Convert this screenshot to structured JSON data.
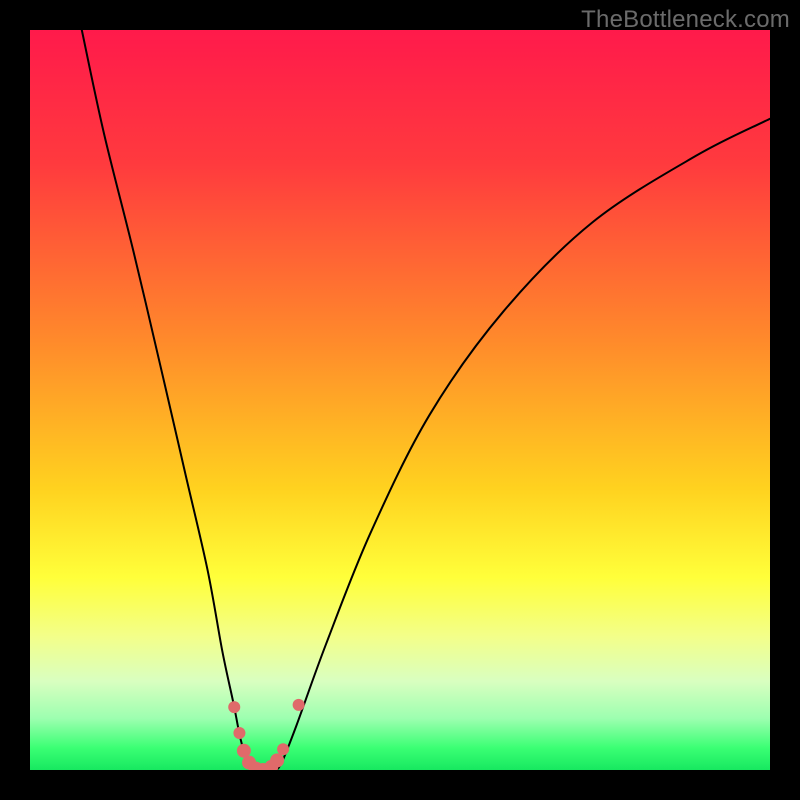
{
  "watermark": "TheBottleneck.com",
  "chart_data": {
    "type": "line",
    "title": "",
    "xlabel": "",
    "ylabel": "",
    "xlim": [
      0,
      100
    ],
    "ylim": [
      0,
      100
    ],
    "gradient_stops": [
      {
        "offset": 0,
        "color": "#ff1a4b"
      },
      {
        "offset": 18,
        "color": "#ff3a3e"
      },
      {
        "offset": 42,
        "color": "#ff8a2b"
      },
      {
        "offset": 62,
        "color": "#ffd21f"
      },
      {
        "offset": 74,
        "color": "#ffff3a"
      },
      {
        "offset": 82,
        "color": "#f3ff8a"
      },
      {
        "offset": 88,
        "color": "#d9ffc0"
      },
      {
        "offset": 93,
        "color": "#9dffb0"
      },
      {
        "offset": 97,
        "color": "#3bff74"
      },
      {
        "offset": 100,
        "color": "#17e860"
      }
    ],
    "series": [
      {
        "name": "bottleneck-curve",
        "x": [
          7,
          10,
          14,
          18,
          21,
          24,
          26,
          27.5,
          28.5,
          29.5,
          31,
          33,
          34,
          36,
          40,
          46,
          54,
          64,
          76,
          90,
          100
        ],
        "y": [
          100,
          86,
          70,
          53,
          40,
          27,
          16,
          9,
          4,
          1,
          0,
          0,
          1,
          6,
          17,
          32,
          48,
          62,
          74,
          83,
          88
        ]
      }
    ],
    "markers": {
      "name": "highlight-dots",
      "color": "#e06a6a",
      "points": [
        {
          "x": 27.6,
          "y": 8.5,
          "r": 6
        },
        {
          "x": 28.3,
          "y": 5.0,
          "r": 6
        },
        {
          "x": 28.9,
          "y": 2.6,
          "r": 7
        },
        {
          "x": 29.6,
          "y": 1.0,
          "r": 7
        },
        {
          "x": 30.5,
          "y": 0.2,
          "r": 7
        },
        {
          "x": 31.5,
          "y": 0.0,
          "r": 7
        },
        {
          "x": 32.6,
          "y": 0.4,
          "r": 7
        },
        {
          "x": 33.4,
          "y": 1.3,
          "r": 7
        },
        {
          "x": 34.2,
          "y": 2.8,
          "r": 6
        },
        {
          "x": 36.3,
          "y": 8.8,
          "r": 6
        }
      ]
    }
  }
}
